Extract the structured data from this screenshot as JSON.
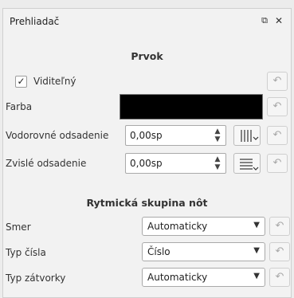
{
  "panel": {
    "title": "Prehliadač",
    "float_icon": "float-icon",
    "close_icon": "close-icon"
  },
  "prvok": {
    "title": "Prvok",
    "visible": {
      "label": "Viditeľný",
      "checked": true
    },
    "color": {
      "label": "Farba",
      "value": "#000000"
    },
    "h_offset": {
      "label": "Vodorovné odsadenie",
      "value": "0,00sp"
    },
    "v_offset": {
      "label": "Zvislé odsadenie",
      "value": "0,00sp"
    }
  },
  "rhythm": {
    "title": "Rytmická skupina nôt",
    "direction": {
      "label": "Smer",
      "value": "Automaticky"
    },
    "number_type": {
      "label": "Typ čísla",
      "value": "Číslo"
    },
    "bracket_type": {
      "label": "Typ zátvorky",
      "value": "Automaticky"
    }
  },
  "icons": {
    "reset": "reset-icon",
    "checkmark": "checkmark-icon",
    "spin_up": "spin-up-icon",
    "spin_down": "spin-down-icon",
    "combo_arrow": "chevron-down-icon"
  }
}
